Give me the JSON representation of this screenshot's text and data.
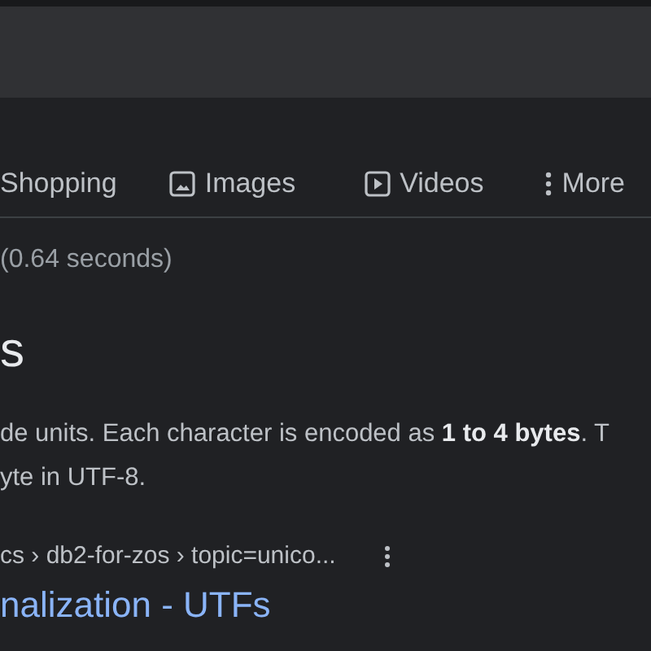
{
  "tabs": [
    {
      "label": "Shopping",
      "kind": "plain",
      "selected": false
    },
    {
      "label": "Images",
      "kind": "image",
      "selected": false
    },
    {
      "label": "Videos",
      "kind": "video",
      "selected": false
    },
    {
      "label": "More",
      "kind": "menu",
      "selected": false
    }
  ],
  "result_stats": "(0.64 seconds)",
  "heading": "s",
  "snippet": [
    "de units. Each character is encoded as **1 to 4 bytes**. T",
    "yte in UTF-8."
  ],
  "result": {
    "breadcrumb": "cs › db2-for-zos › topic=unico...",
    "title": "nalization - UTFs"
  }
}
